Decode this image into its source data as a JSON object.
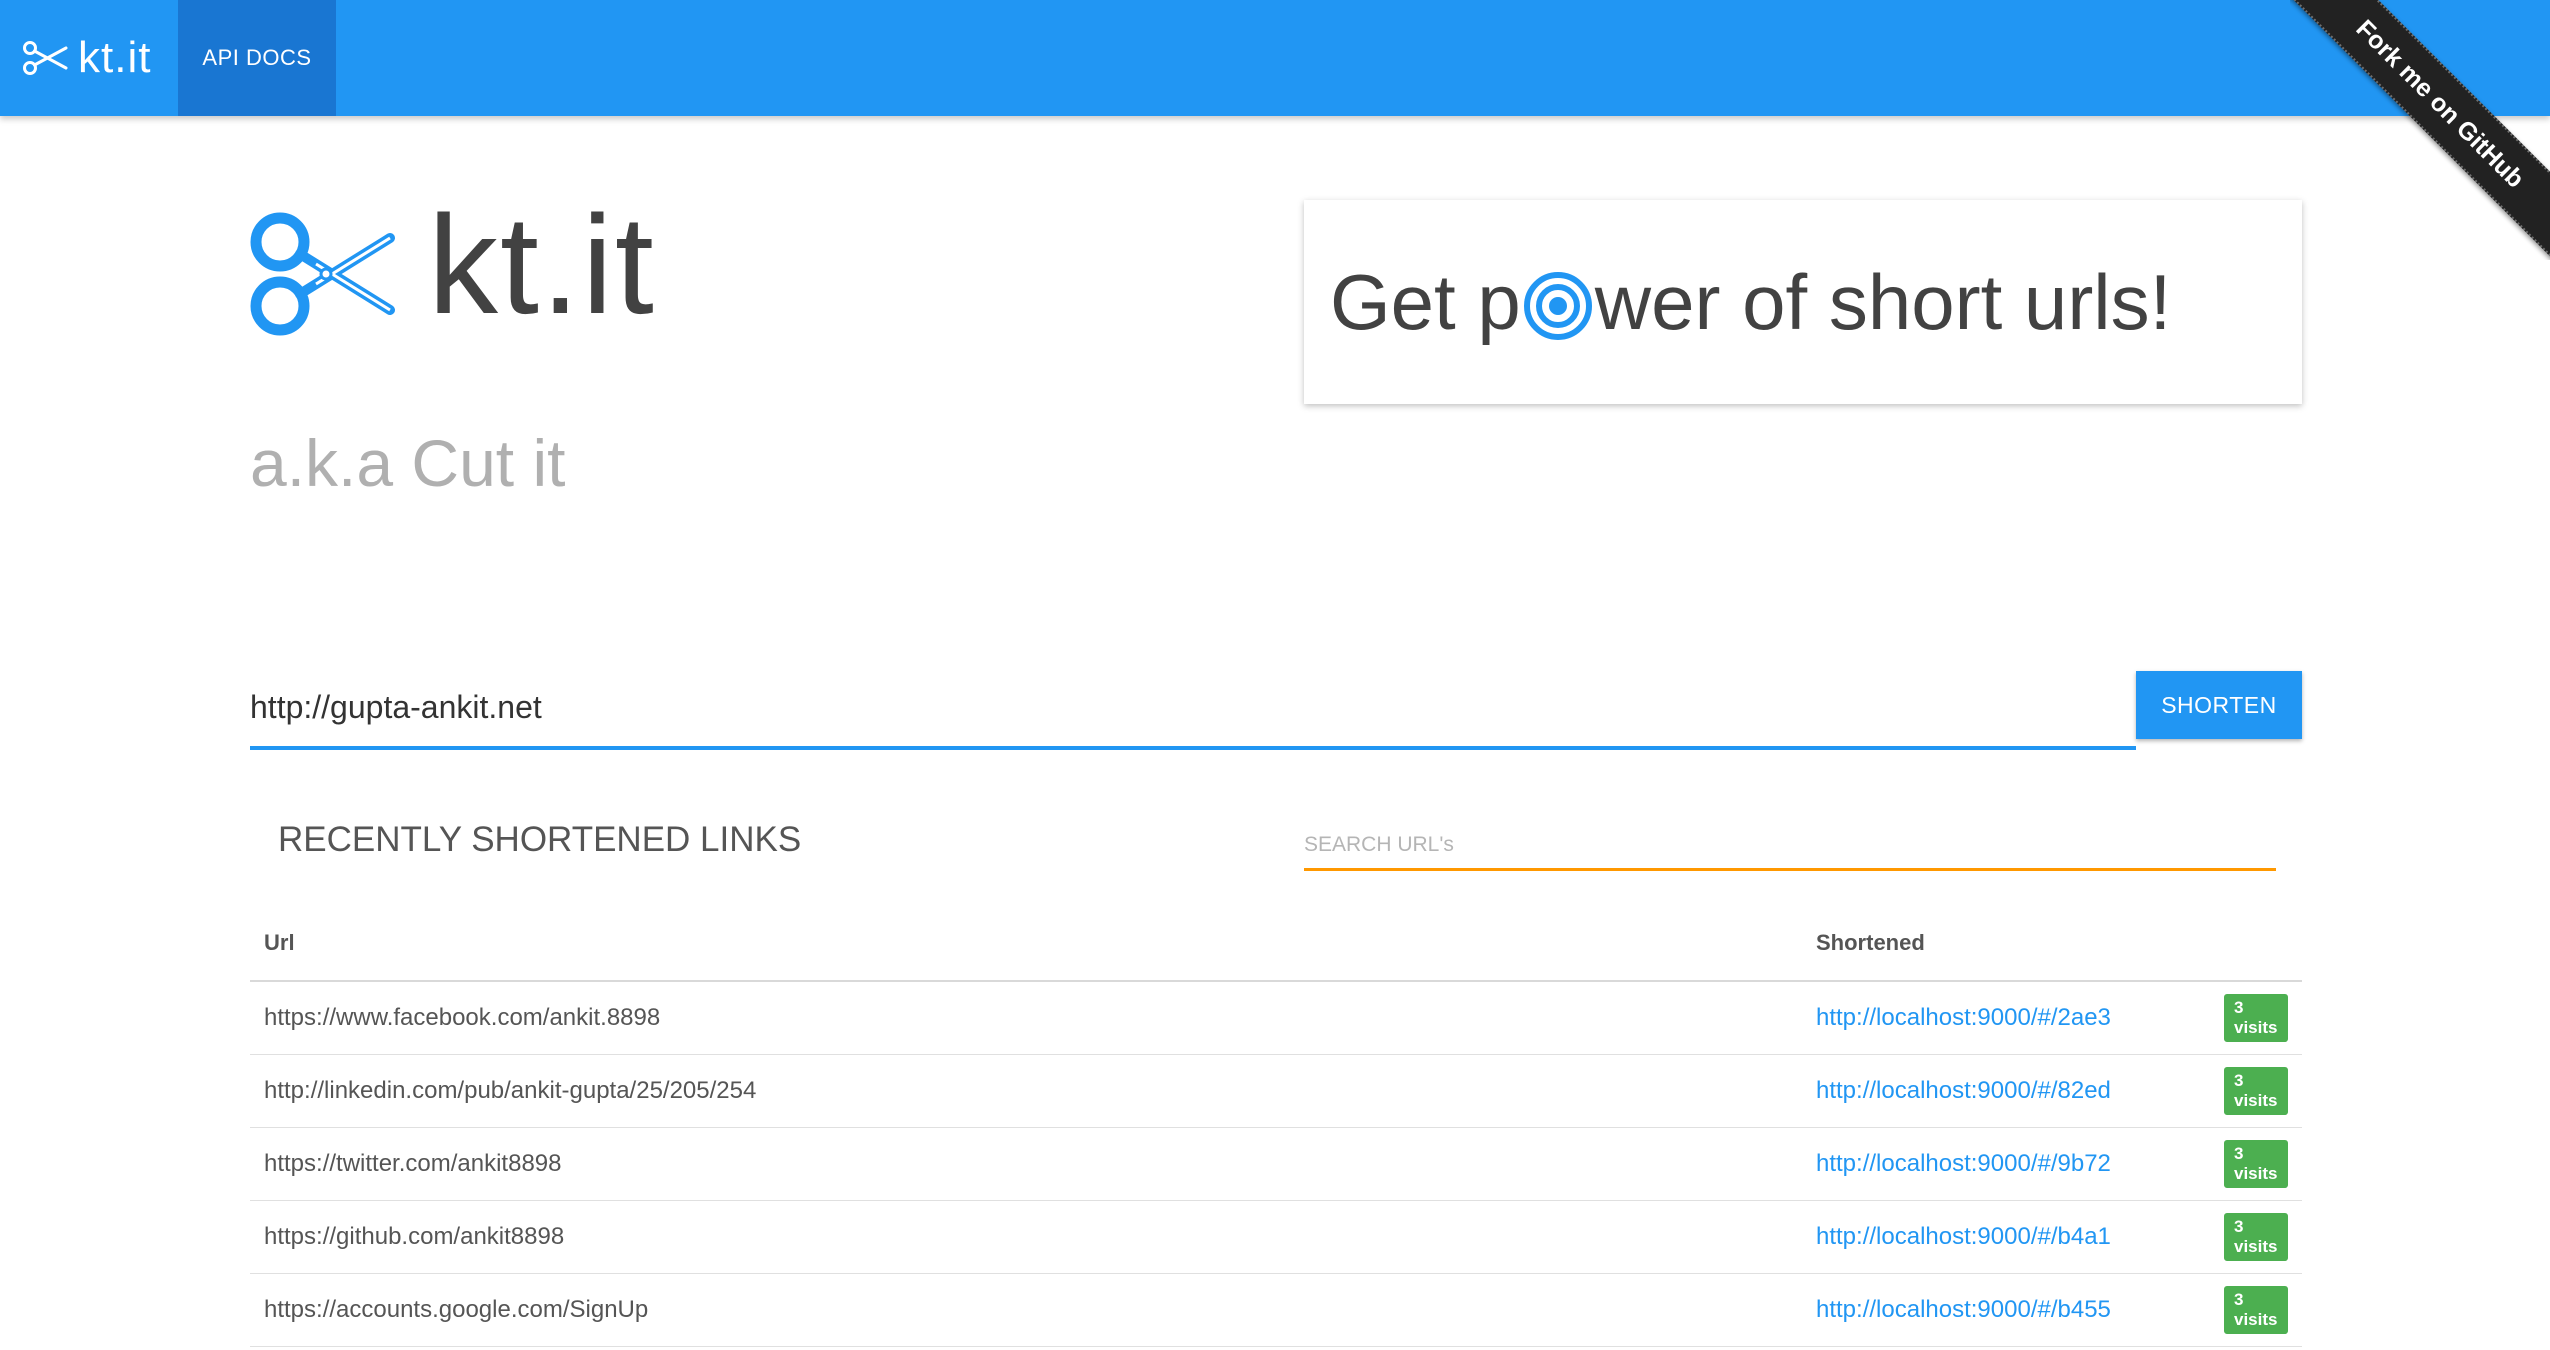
{
  "nav": {
    "brand": "kt.it",
    "api_docs": "API DOCS",
    "ribbon": "Fork me on GitHub"
  },
  "hero": {
    "title": "kt.it",
    "subtitle": "a.k.a Cut it",
    "tagline_prefix": "Get p",
    "tagline_suffix": "wer of short urls!",
    "tagline_icon": "target-icon"
  },
  "form": {
    "url_value": "http://gupta-ankit.net",
    "shorten_label": "SHORTEN"
  },
  "recent": {
    "title": "RECENTLY SHORTENED LINKS",
    "search_placeholder": "SEARCH URL's",
    "columns": [
      "Url",
      "Shortened"
    ],
    "rows": [
      {
        "url": "https://www.facebook.com/ankit.8898",
        "short": "http://localhost:9000/#/2ae3",
        "visits": "3 visits"
      },
      {
        "url": "http://linkedin.com/pub/ankit-gupta/25/205/254",
        "short": "http://localhost:9000/#/82ed",
        "visits": "3 visits"
      },
      {
        "url": "https://twitter.com/ankit8898",
        "short": "http://localhost:9000/#/9b72",
        "visits": "3 visits"
      },
      {
        "url": "https://github.com/ankit8898",
        "short": "http://localhost:9000/#/b4a1",
        "visits": "3 visits"
      },
      {
        "url": "https://accounts.google.com/SignUp",
        "short": "http://localhost:9000/#/b455",
        "visits": "3 visits"
      }
    ]
  },
  "colors": {
    "primary": "#2196f3",
    "primary_dark": "#1976d2",
    "accent": "#ff9800",
    "badge": "#4caf50"
  }
}
